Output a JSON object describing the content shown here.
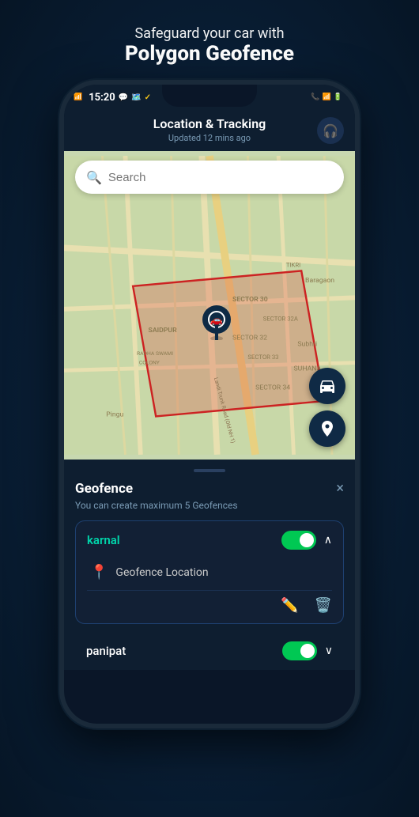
{
  "headline": {
    "subtitle": "Safeguard your car with",
    "title": "Polygon Geofence"
  },
  "status_bar": {
    "time": "15:20",
    "network": "4G",
    "wifi": "WiFi",
    "battery": "Bat"
  },
  "app_header": {
    "title": "Location & Tracking",
    "subtitle": "Updated 12 mins ago",
    "support_icon": "🎧"
  },
  "search": {
    "placeholder": "Search"
  },
  "map_fabs": [
    {
      "icon": "car",
      "label": "car-location-fab"
    },
    {
      "icon": "pin",
      "label": "pin-location-fab"
    }
  ],
  "bottom_panel": {
    "drag_indicator": true,
    "title": "Geofence",
    "close": "×",
    "description": "You can create maximum 5 Geofences",
    "geofences": [
      {
        "name": "karnal",
        "enabled": true,
        "expanded": true,
        "location_label": "Geofence Location"
      },
      {
        "name": "panipat",
        "enabled": true,
        "expanded": false
      }
    ]
  }
}
